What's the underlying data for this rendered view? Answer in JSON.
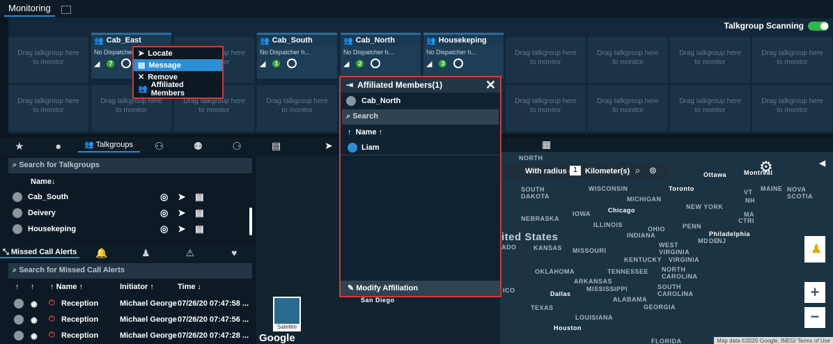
{
  "top": {
    "tab_label": "Monitoring",
    "talkgroup_scanning": "Talkgroup Scanning"
  },
  "slots": {
    "drag_text": "Drag talkgroup here",
    "drag_text2": "to monitor",
    "cards": [
      {
        "name": "Cab_East",
        "sub": "No Dispatcher h...",
        "badge": "7"
      },
      {
        "name": "Cab_South",
        "sub": "No Dispatcher h...",
        "badge": "1"
      },
      {
        "name": "Cab_North",
        "sub": "No Dispatcher h...",
        "badge": "2"
      },
      {
        "name": "Housekeping",
        "sub": "No Dispatcher h...",
        "badge": "3"
      }
    ]
  },
  "context_menu": {
    "items": [
      "Locate",
      "Message",
      "Remove",
      "Affiliated Members"
    ]
  },
  "left": {
    "tab_talkgroups": "Talkgroups",
    "search_talkgroups": "Search for Talkgroups",
    "name_header": "Name",
    "talkgroups": [
      "Cab_South",
      "Deivery",
      "Housekeping"
    ],
    "missed_tab": "Missed Call Alerts",
    "search_missed": "Search for Missed Call Alerts",
    "col_name": "Name",
    "col_initiator": "Initiator",
    "col_time": "Time",
    "alerts": [
      {
        "name": "Reception",
        "initiator": "Michael George",
        "time": "07/26/20 07:47:58 ..."
      },
      {
        "name": "Reception",
        "initiator": "Michael George",
        "time": "07/26/20 07:47:56 ..."
      },
      {
        "name": "Reception",
        "initiator": "Michael George",
        "time": "07/26/20 07:47:28 ..."
      }
    ]
  },
  "affiliated": {
    "title": "Affiliated Members(1)",
    "group": "Cab_North",
    "search": "Search",
    "name_header": "Name",
    "members": [
      "Liam"
    ],
    "modify": "Modify Affiliation"
  },
  "map": {
    "radius_label": "With radius of",
    "radius_value": "1",
    "radius_unit": "Kilometer(s)",
    "labels": [
      "NORTH",
      "SOUTH DAKOTA",
      "WISCONSIN",
      "MICHIGAN",
      "Toronto",
      "Ottawa",
      "Montreal",
      "MAINE",
      "NOVA SCOTIA",
      "VT",
      "NH",
      "MA",
      "CTRI",
      "NEW YORK",
      "IOWA",
      "Chicago",
      "NEBRASKA",
      "ILLINOIS",
      "OHIO",
      "PENN",
      "INDIANA",
      "Philadelphia",
      "MD",
      "DE",
      "NJ",
      "ited States",
      "ADO",
      "KANSAS",
      "MISSOURI",
      "WEST VIRGINIA",
      "VIRGINIA",
      "KENTUCKY",
      "OKLAHOMA",
      "TENNESSEE",
      "NORTH CAROLINA",
      "ARKANSAS",
      "MISSISSIPPI",
      "SOUTH CAROLINA",
      "ALABAMA",
      "GEORGIA",
      "Dallas",
      "TEXAS",
      "LOUISIANA",
      "Houston",
      "San Diego",
      "ICO",
      "FLORIDA"
    ],
    "satellite": "Satellite",
    "google": "Google",
    "footer": "Map data ©2020 Google, INEGI   Terms of Use"
  }
}
